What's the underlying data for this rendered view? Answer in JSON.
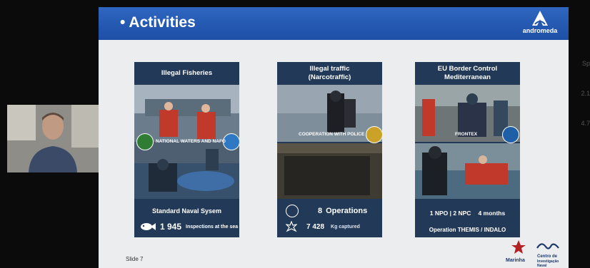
{
  "slide": {
    "title": "• Activities",
    "brand": "andromeda",
    "slide_number": "Slide 7",
    "logos": {
      "left": "Marinha",
      "right_top": "Centro de",
      "right_bottom": "Investigação Naval"
    }
  },
  "cards": [
    {
      "title_line1": "Illegal Fisheries",
      "title_line2": "",
      "tag": "NATIONAL WATERS AND NAFO",
      "footer_title": "Standard Naval Sysem",
      "metric_value": "1 945",
      "metric_label": "Inspections at the sea"
    },
    {
      "title_line1": "Illegal traffic",
      "title_line2": "(Narcotraffic)",
      "tag": "COOPERATION WITH POLICE",
      "stat1_value": "8",
      "stat1_label": "Operations",
      "stat2_value": "7 428",
      "stat2_label": "Kg captured"
    },
    {
      "title_line1": "EU Border Control",
      "title_line2": "Mediterranean",
      "tag": "FRONTEX",
      "line1": "1 NPO | 2 NPC",
      "line1_b": "4 months",
      "line2": "Operation THEMIS / INDALO"
    }
  ],
  "side_text": [
    "Sp",
    "2.1",
    "4.7"
  ]
}
